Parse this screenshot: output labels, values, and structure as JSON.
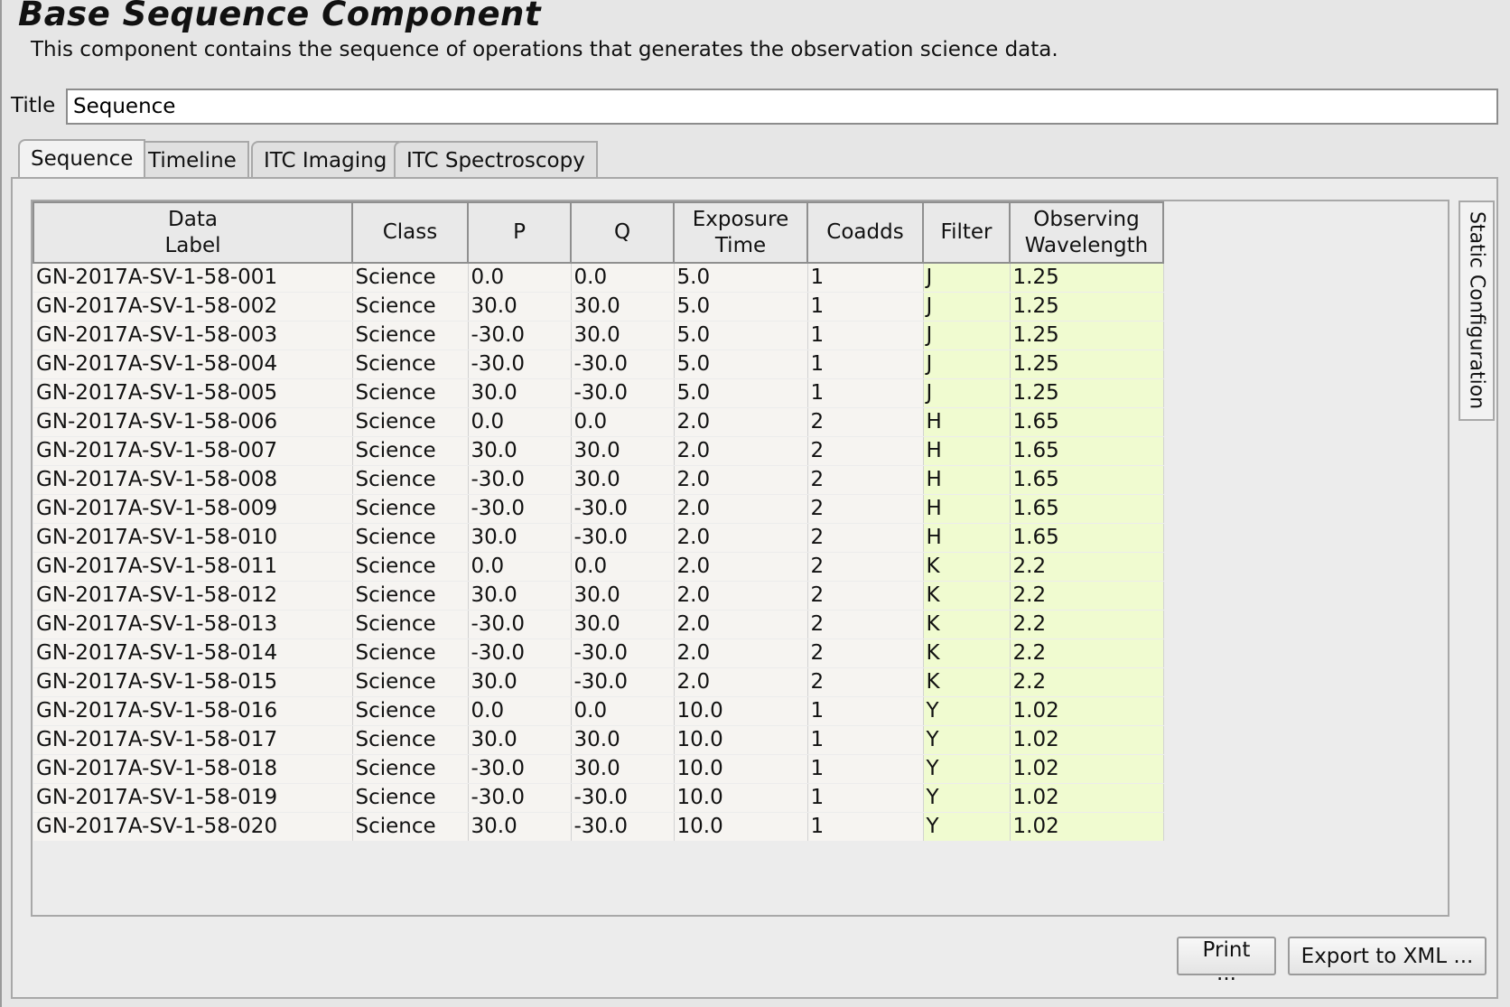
{
  "header": {
    "title": "Base Sequence Component",
    "description": "This component contains the sequence of operations that generates the observation science data."
  },
  "title_field": {
    "label": "Title",
    "value": "Sequence"
  },
  "tabs": [
    {
      "label": "Sequence",
      "active": true
    },
    {
      "label": "Timeline",
      "active": false
    },
    {
      "label": "ITC Imaging",
      "active": false
    },
    {
      "label": "ITC Spectroscopy",
      "active": false
    }
  ],
  "table": {
    "columns": [
      {
        "label_line1": "Data",
        "label_line2": "Label"
      },
      {
        "label_line1": "Class",
        "label_line2": ""
      },
      {
        "label_line1": "P",
        "label_line2": ""
      },
      {
        "label_line1": "Q",
        "label_line2": ""
      },
      {
        "label_line1": "Exposure",
        "label_line2": "Time"
      },
      {
        "label_line1": "Coadds",
        "label_line2": ""
      },
      {
        "label_line1": "Filter",
        "label_line2": ""
      },
      {
        "label_line1": "Observing",
        "label_line2": "Wavelength"
      }
    ],
    "highlight_color": "#f0fbd0",
    "rows": [
      [
        "GN-2017A-SV-1-58-001",
        "Science",
        "0.0",
        "0.0",
        "5.0",
        "1",
        "J",
        "1.25"
      ],
      [
        "GN-2017A-SV-1-58-002",
        "Science",
        "30.0",
        "30.0",
        "5.0",
        "1",
        "J",
        "1.25"
      ],
      [
        "GN-2017A-SV-1-58-003",
        "Science",
        "-30.0",
        "30.0",
        "5.0",
        "1",
        "J",
        "1.25"
      ],
      [
        "GN-2017A-SV-1-58-004",
        "Science",
        "-30.0",
        "-30.0",
        "5.0",
        "1",
        "J",
        "1.25"
      ],
      [
        "GN-2017A-SV-1-58-005",
        "Science",
        "30.0",
        "-30.0",
        "5.0",
        "1",
        "J",
        "1.25"
      ],
      [
        "GN-2017A-SV-1-58-006",
        "Science",
        "0.0",
        "0.0",
        "2.0",
        "2",
        "H",
        "1.65"
      ],
      [
        "GN-2017A-SV-1-58-007",
        "Science",
        "30.0",
        "30.0",
        "2.0",
        "2",
        "H",
        "1.65"
      ],
      [
        "GN-2017A-SV-1-58-008",
        "Science",
        "-30.0",
        "30.0",
        "2.0",
        "2",
        "H",
        "1.65"
      ],
      [
        "GN-2017A-SV-1-58-009",
        "Science",
        "-30.0",
        "-30.0",
        "2.0",
        "2",
        "H",
        "1.65"
      ],
      [
        "GN-2017A-SV-1-58-010",
        "Science",
        "30.0",
        "-30.0",
        "2.0",
        "2",
        "H",
        "1.65"
      ],
      [
        "GN-2017A-SV-1-58-011",
        "Science",
        "0.0",
        "0.0",
        "2.0",
        "2",
        "K",
        "2.2"
      ],
      [
        "GN-2017A-SV-1-58-012",
        "Science",
        "30.0",
        "30.0",
        "2.0",
        "2",
        "K",
        "2.2"
      ],
      [
        "GN-2017A-SV-1-58-013",
        "Science",
        "-30.0",
        "30.0",
        "2.0",
        "2",
        "K",
        "2.2"
      ],
      [
        "GN-2017A-SV-1-58-014",
        "Science",
        "-30.0",
        "-30.0",
        "2.0",
        "2",
        "K",
        "2.2"
      ],
      [
        "GN-2017A-SV-1-58-015",
        "Science",
        "30.0",
        "-30.0",
        "2.0",
        "2",
        "K",
        "2.2"
      ],
      [
        "GN-2017A-SV-1-58-016",
        "Science",
        "0.0",
        "0.0",
        "10.0",
        "1",
        "Y",
        "1.02"
      ],
      [
        "GN-2017A-SV-1-58-017",
        "Science",
        "30.0",
        "30.0",
        "10.0",
        "1",
        "Y",
        "1.02"
      ],
      [
        "GN-2017A-SV-1-58-018",
        "Science",
        "-30.0",
        "30.0",
        "10.0",
        "1",
        "Y",
        "1.02"
      ],
      [
        "GN-2017A-SV-1-58-019",
        "Science",
        "-30.0",
        "-30.0",
        "10.0",
        "1",
        "Y",
        "1.02"
      ],
      [
        "GN-2017A-SV-1-58-020",
        "Science",
        "30.0",
        "-30.0",
        "10.0",
        "1",
        "Y",
        "1.02"
      ]
    ]
  },
  "side_panel": {
    "label": "Static Configuration"
  },
  "buttons": {
    "print_label": "Print ...",
    "export_label": "Export to XML ..."
  }
}
